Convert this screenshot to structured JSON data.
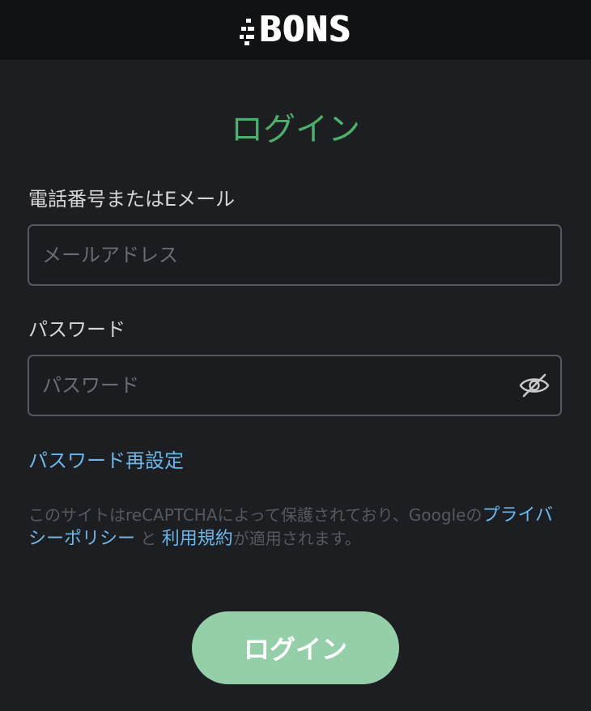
{
  "header": {
    "logo_text": "BONS"
  },
  "login": {
    "title": "ログイン",
    "email_label": "電話番号またはEメール",
    "email_placeholder": "メールアドレス",
    "email_value": "",
    "password_label": "パスワード",
    "password_placeholder": "パスワード",
    "password_value": "",
    "password_toggle_icon": "eye-slash-icon",
    "reset_link": "パスワード再設定",
    "submit_label": "ログイン"
  },
  "recaptcha_notice": {
    "part1": "このサイトはreCAPTCHAによって保護されており、Googleの",
    "privacy_link": "プライバシーポリシー",
    "part2": "と",
    "terms_link": "利用規約",
    "part3": "が適用されます。"
  },
  "colors": {
    "background": "#1d1e21",
    "header_background": "#111214",
    "accent_green": "#4caf6a",
    "button_green": "#94cfaa",
    "link_blue": "#6bb6ea"
  }
}
